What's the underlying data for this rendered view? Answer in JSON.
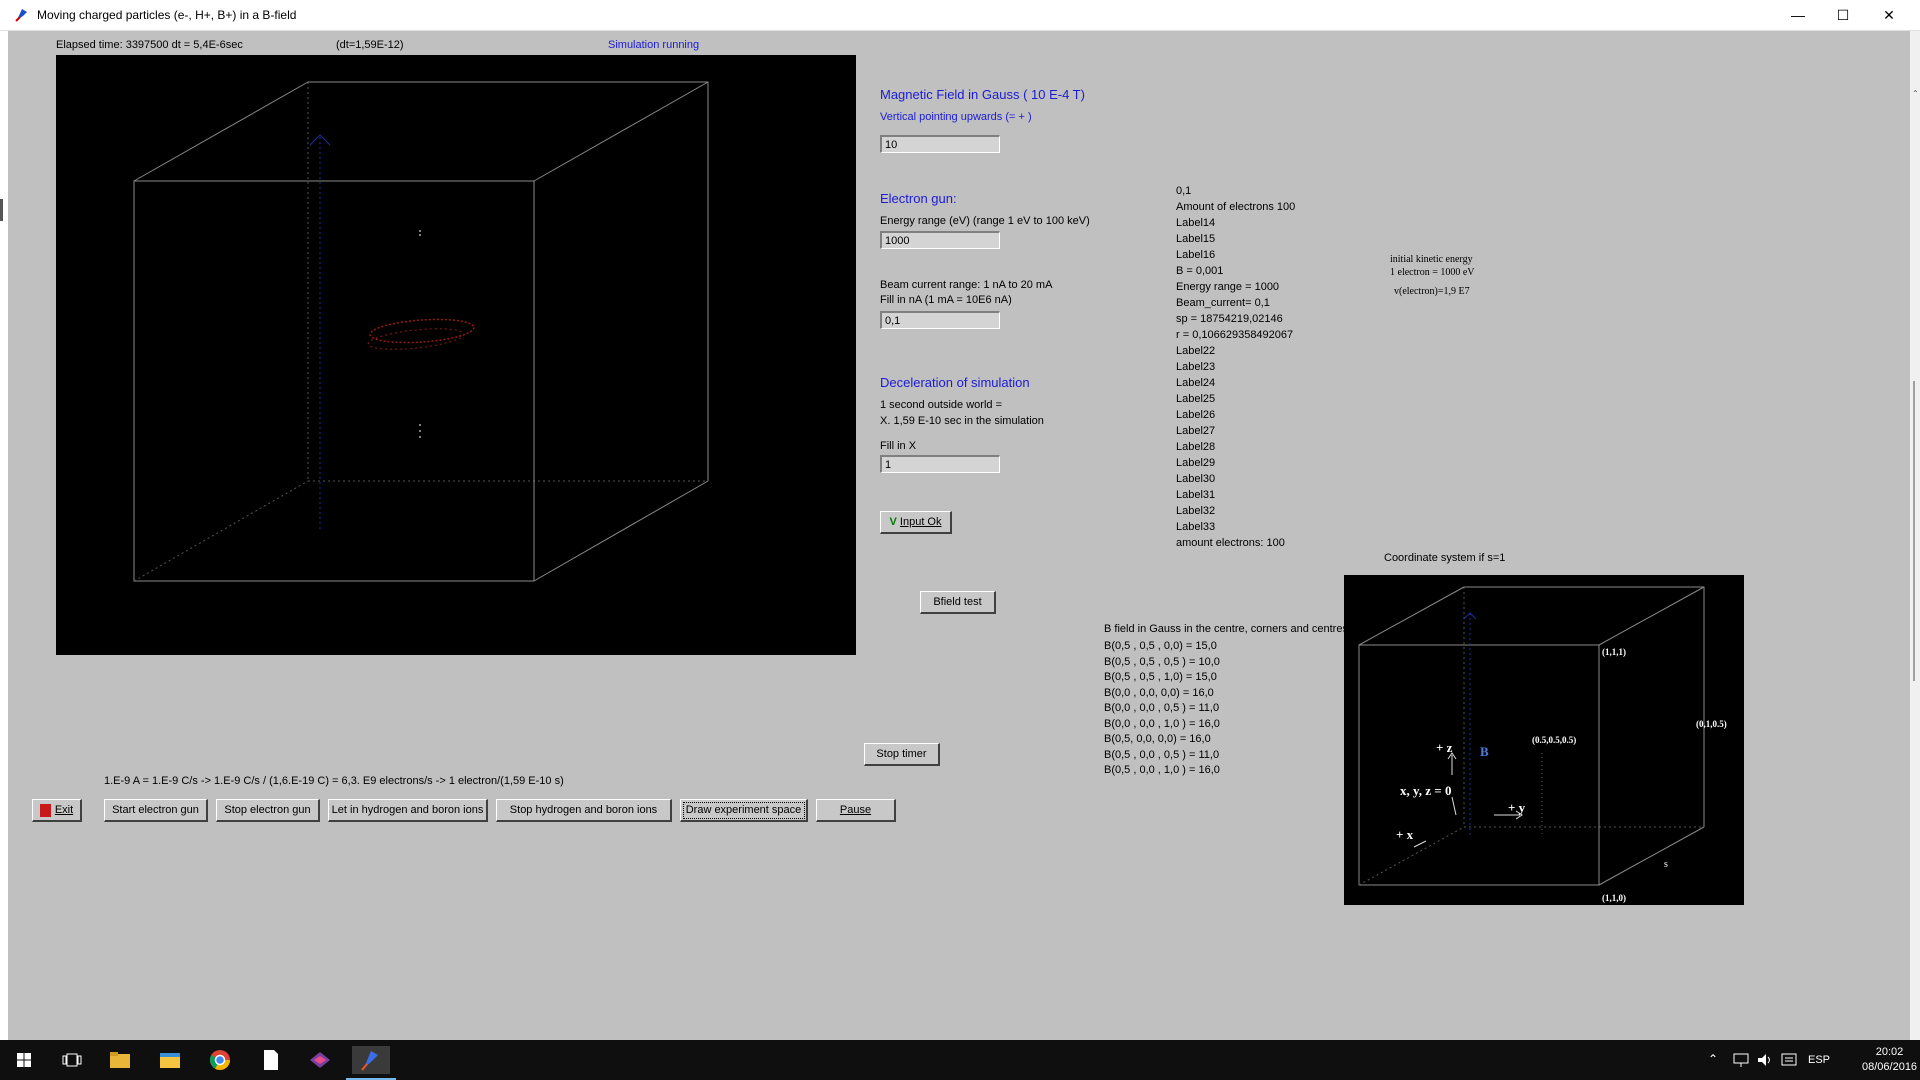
{
  "window": {
    "title": "Moving charged particles (e-, H+, B+) in a B-field",
    "minimize": "—",
    "maximize": "☐",
    "close": "✕"
  },
  "status": {
    "elapsed": "Elapsed time: 3397500 dt   = 5,4E-6sec",
    "dt": "(dt=1,59E-12)",
    "running": "Simulation running"
  },
  "magnetic": {
    "header": "Magnetic Field in Gauss ( 10 E-4 T)",
    "sub": "Vertical pointing upwards (= + )",
    "value": "10"
  },
  "gun": {
    "header": "Electron gun:",
    "energy_label": "Energy range (eV)     (range 1 eV to 100 keV)",
    "energy_value": "1000",
    "beam_label1": "Beam current range: 1 nA to 20 mA",
    "beam_label2": "Fill in nA (1 mA = 10E6 nA)",
    "beam_value": "0,1"
  },
  "decel": {
    "header": "Deceleration of simulation",
    "line1": "1 second outside world  =",
    "line2": "X. 1,59 E-10 sec in the simulation",
    "fill_label": "Fill in X",
    "value": "1"
  },
  "buttons": {
    "input_ok": "Input Ok",
    "input_ok_check": "V",
    "bfield_test": "Bfield test",
    "stop_timer": "Stop timer",
    "exit": "Exit",
    "start_gun": "Start electron gun",
    "stop_gun": "Stop electron gun",
    "let_in": "Let in hydrogen and boron ions",
    "stop_ions": "Stop hydrogen and boron ions",
    "draw": "Draw experiment space",
    "pause": "Pause"
  },
  "info_labels": [
    "0,1",
    "Amount of electrons 100",
    "Label14",
    "Label15",
    "Label16",
    "B = 0,001",
    "Energy range = 1000",
    "Beam_current= 0,1",
    "sp =  18754219,02146",
    "r =  0,106629358492067",
    "Label22",
    "Label23",
    "Label24",
    "Label25",
    "Label26",
    "Label27",
    "Label28",
    "Label29",
    "Label30",
    "Label31",
    "Label32",
    "Label33",
    "amount electrons: 100"
  ],
  "kinetic": {
    "line1": "initial kinetic energy",
    "line2": "1 electron = 1000 eV",
    "line3": "v(electron)=1,9 E7"
  },
  "coord": {
    "title": "Coordinate system if s=1",
    "p111": "(1,1,1)",
    "p0105": "(0,1,0.5)",
    "pcenter": "(0.5,0.5,0.5)",
    "p110": "(1,1,0)",
    "s": "s",
    "plusz": "+ z",
    "B": "B",
    "origin": "x, y, z = 0",
    "plusy": "+ y",
    "plusx": "+ x"
  },
  "bfield": {
    "title": "B field in Gauss in the centre, corners and centres o",
    "rows": [
      "B(0,5 , 0,5 , 0,0) = 15,0",
      "B(0,5 , 0,5 , 0,5 ) = 10,0",
      "B(0,5 , 0,5 , 1,0) = 15,0",
      "B(0,0 , 0,0, 0,0) = 16,0",
      "B(0,0 , 0,0 , 0,5 ) = 11,0",
      "B(0,0 , 0,0 , 1,0 ) = 16,0",
      "B(0,5, 0,0, 0,0) = 16,0",
      "B(0,5 , 0,0 , 0,5 ) = 11,0",
      "B(0,5 , 0,0 , 1,0 ) = 16,0"
    ]
  },
  "formula": "1.E-9 A = 1.E-9 C/s  ->  1.E-9 C/s / (1,6.E-19 C) = 6,3. E9   electrons/s  -> 1 electron/(1,59 E-10 s)",
  "tray": {
    "lang": "ESP",
    "time": "20:02",
    "date": "08/06/2016"
  }
}
